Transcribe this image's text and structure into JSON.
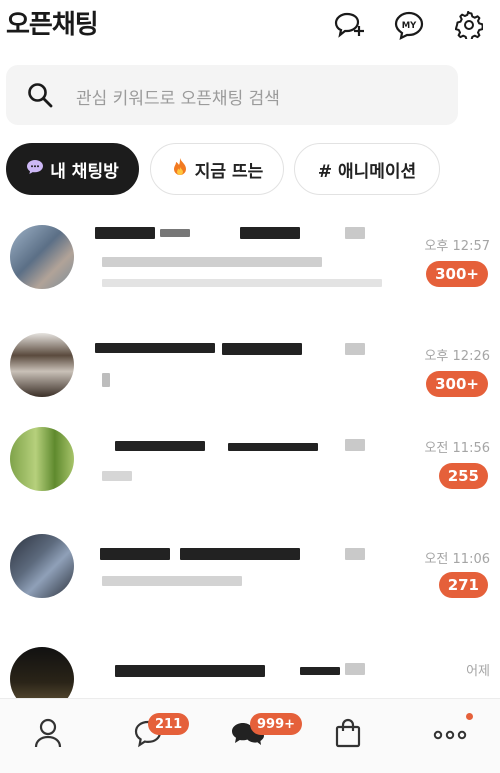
{
  "header": {
    "title": "오픈채팅",
    "icons": [
      "add-chat-icon",
      "my-profile-icon",
      "settings-icon"
    ],
    "my_label": "MY"
  },
  "search": {
    "placeholder": "관심 키워드로 오픈채팅 검색"
  },
  "chips": [
    {
      "label": "내 채팅방",
      "icon": "chat-bubble-icon",
      "active": true
    },
    {
      "label": "지금 뜨는",
      "icon": "fire-icon",
      "active": false
    },
    {
      "label": "# 애니메이션",
      "icon": "hash-icon",
      "active": false
    }
  ],
  "chats": [
    {
      "time": "오후 12:57",
      "badge": "300+"
    },
    {
      "time": "오후 12:26",
      "badge": "300+"
    },
    {
      "time": "오전 11:56",
      "badge": "255"
    },
    {
      "time": "오전 11:06",
      "badge": "271"
    },
    {
      "time": "어제",
      "badge": ""
    }
  ],
  "tabbar": {
    "items": [
      "friends-tab",
      "chats-tab",
      "openchat-tab",
      "shopping-tab",
      "more-tab"
    ],
    "chats_badge": "211",
    "openchat_badge": "999+"
  },
  "colors": {
    "accent": "#e5603a",
    "active_chip": "#1c1c1c"
  }
}
